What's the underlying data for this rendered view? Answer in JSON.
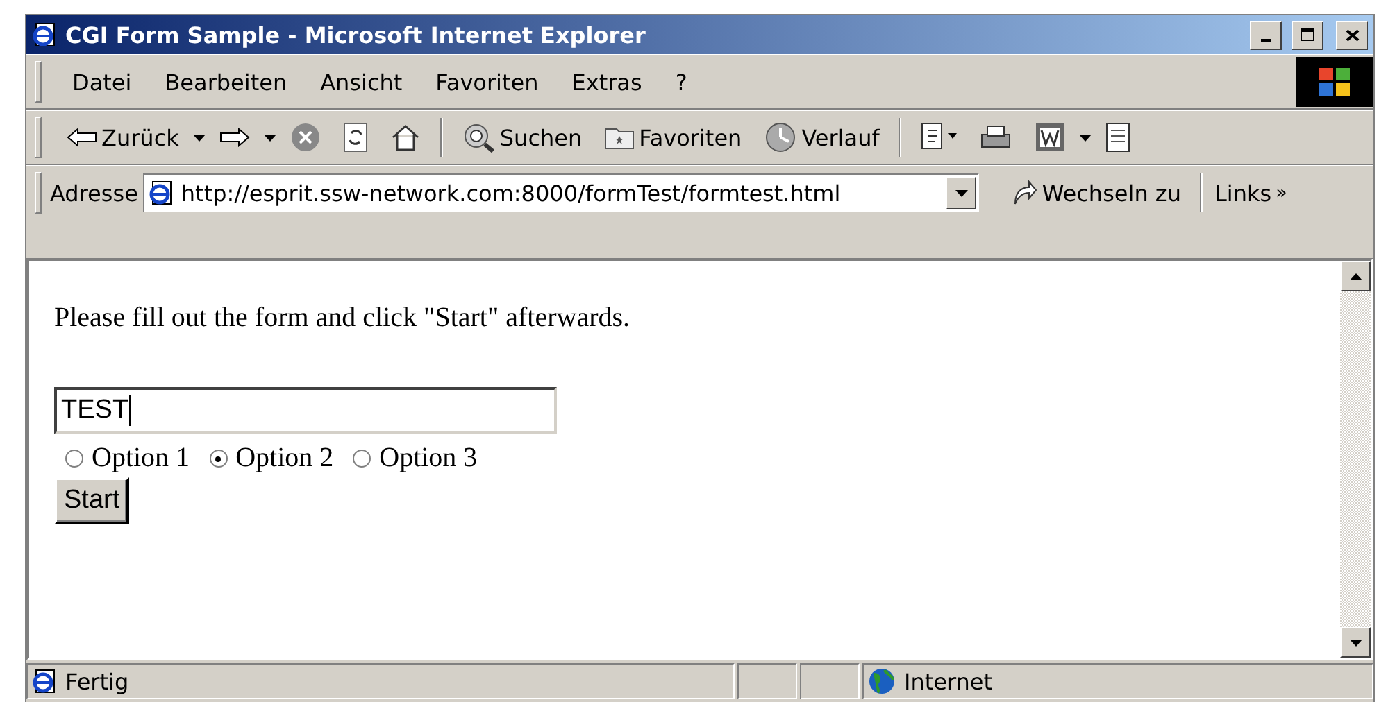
{
  "window": {
    "title": "CGI Form Sample - Microsoft Internet Explorer"
  },
  "menu": [
    "Datei",
    "Bearbeiten",
    "Ansicht",
    "Favoriten",
    "Extras",
    "?"
  ],
  "toolbar": {
    "back": "Zurück",
    "search": "Suchen",
    "favorites": "Favoriten",
    "history": "Verlauf"
  },
  "address_bar": {
    "label": "Adresse",
    "url": "http://esprit.ssw-network.com:8000/formTest/formtest.html",
    "go": "Wechseln zu",
    "links": "Links",
    "links_more": "»"
  },
  "page": {
    "instruction": "Please fill out the form and click \"Start\" afterwards.",
    "text_field": {
      "value": "TEST"
    },
    "options": [
      {
        "label": "Option 1",
        "selected": false
      },
      {
        "label": "Option 2",
        "selected": true
      },
      {
        "label": "Option 3",
        "selected": false
      }
    ],
    "button": "Start"
  },
  "status_bar": {
    "status": "Fertig",
    "zone": "Internet"
  }
}
